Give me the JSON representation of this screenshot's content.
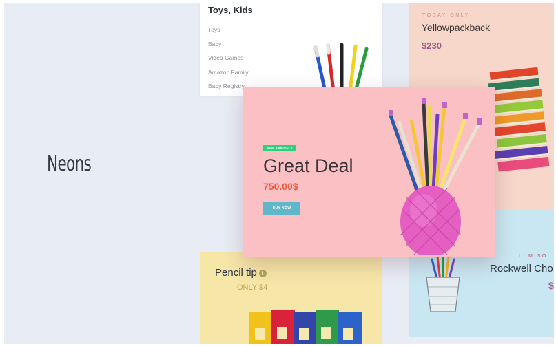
{
  "brand": {
    "name": "Neons"
  },
  "category_card": {
    "title": "Toys, Kids",
    "items": [
      "Toys",
      "Baby",
      "Video Games",
      "Amazon Family",
      "Baby Registry"
    ]
  },
  "peach_card": {
    "eyebrow": "TODAY ONLY",
    "title": "Yellowpackback",
    "price": "$230"
  },
  "featured_card": {
    "badge": "NEW ARRIVALS",
    "title": "Great Deal",
    "price": "750.00$",
    "button_label": "BUY NOW"
  },
  "blue_card": {
    "eyebrow": "LUMISO",
    "title": "Rockwell Cho",
    "price": "$"
  },
  "yellow_card": {
    "title": "Pencil tip",
    "price": "ONLY $4"
  },
  "icons": [
    "info-icon"
  ],
  "colors": {
    "background": "#e8ecf4",
    "featured_bg": "#fac0c4",
    "peach_bg": "#f6d7c9",
    "blue_bg": "#c9e7f2",
    "yellow_bg": "#f6e6a8",
    "badge_green": "#2bd27a",
    "price_orange": "#ef5a3f",
    "button_blue": "#60b7c9",
    "price_purple": "#a25a8e"
  }
}
